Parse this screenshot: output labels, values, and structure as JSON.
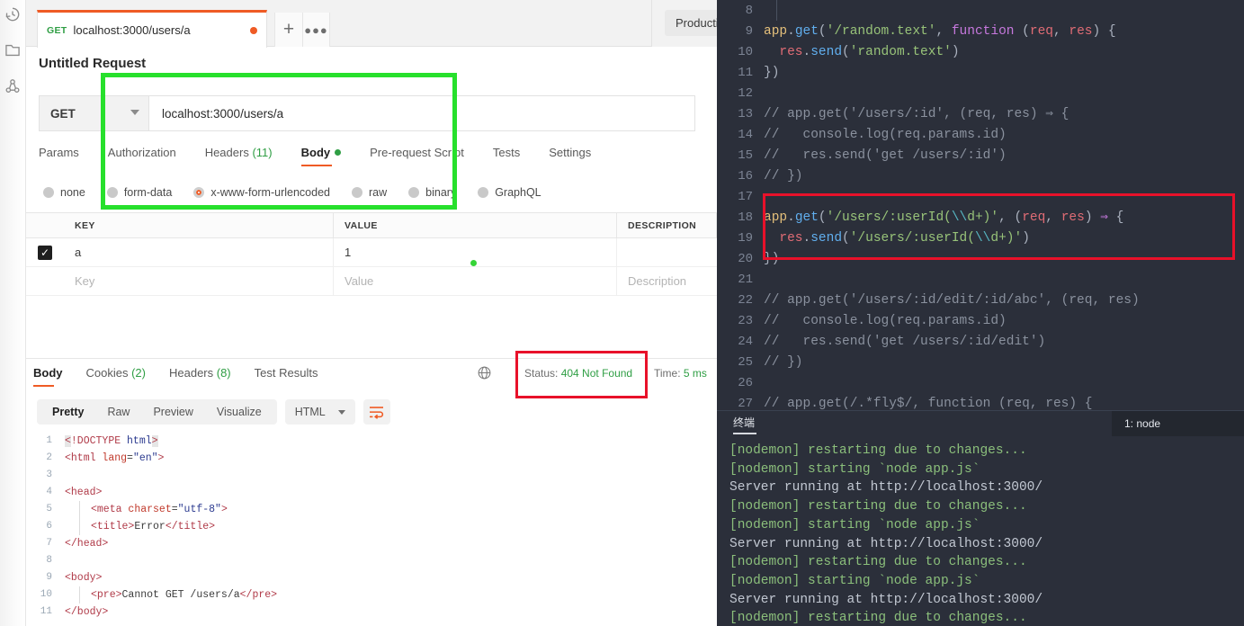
{
  "app": {
    "name": "Postman",
    "accent_orange": "#ef5b25",
    "accent_green": "#2f9e44",
    "annotation_green": "#27e02c",
    "annotation_red": "#e8112a"
  },
  "sidebar": {
    "items": [
      {
        "name": "history-icon",
        "label": "History"
      },
      {
        "name": "collections-icon",
        "label": "Collections"
      },
      {
        "name": "apis-icon",
        "label": "APIs"
      }
    ]
  },
  "tabstrip": {
    "tab": {
      "method": "GET",
      "title": "localhost:3000/users/a",
      "unsaved": true
    },
    "new_tab_label": "+",
    "more_label": "●●●",
    "environment": "Production"
  },
  "request": {
    "title": "Untitled Request",
    "method": "GET",
    "url": "localhost:3000/users/a",
    "tabs": [
      {
        "label": "Params",
        "active": false,
        "count": ""
      },
      {
        "label": "Authorization",
        "active": false,
        "count": ""
      },
      {
        "label": "Headers",
        "active": false,
        "count": "(11)"
      },
      {
        "label": "Body",
        "active": true,
        "count": "",
        "dot": true
      },
      {
        "label": "Pre-request Script",
        "active": false,
        "count": ""
      },
      {
        "label": "Tests",
        "active": false,
        "count": ""
      },
      {
        "label": "Settings",
        "active": false,
        "count": ""
      }
    ],
    "body_types": [
      {
        "label": "none",
        "selected": false
      },
      {
        "label": "form-data",
        "selected": false
      },
      {
        "label": "x-www-form-urlencoded",
        "selected": true
      },
      {
        "label": "raw",
        "selected": false
      },
      {
        "label": "binary",
        "selected": false
      },
      {
        "label": "GraphQL",
        "selected": false
      }
    ],
    "table": {
      "headers": [
        "KEY",
        "VALUE",
        "DESCRIPTION"
      ],
      "rows": [
        {
          "checked": true,
          "key": "a",
          "value": "1",
          "description": ""
        }
      ],
      "placeholders": {
        "key": "Key",
        "value": "Value",
        "description": "Description"
      }
    }
  },
  "response": {
    "tabs": [
      {
        "label": "Body",
        "active": true,
        "count": ""
      },
      {
        "label": "Cookies",
        "active": false,
        "count": "(2)"
      },
      {
        "label": "Headers",
        "active": false,
        "count": "(8)"
      },
      {
        "label": "Test Results",
        "active": false,
        "count": ""
      }
    ],
    "status_label": "Status:",
    "status_value": "404 Not Found",
    "time_label": "Time:",
    "time_value": "5 ms",
    "viewer": {
      "modes": [
        {
          "label": "Pretty",
          "active": true
        },
        {
          "label": "Raw",
          "active": false
        },
        {
          "label": "Preview",
          "active": false
        },
        {
          "label": "Visualize",
          "active": false
        }
      ],
      "language": "HTML",
      "wrap_icon": "word-wrap-icon"
    },
    "code_lines": [
      {
        "n": "1",
        "indent": false,
        "parts": [
          {
            "t": "<",
            "c": "tg",
            "sel": true
          },
          {
            "t": "!DOCTYPE ",
            "c": "tg"
          },
          {
            "t": "html",
            "c": "av"
          },
          {
            "t": ">",
            "c": "tg",
            "sel": true
          }
        ]
      },
      {
        "n": "2",
        "indent": false,
        "parts": [
          {
            "t": "<html ",
            "c": "tg"
          },
          {
            "t": "lang",
            "c": "at"
          },
          {
            "t": "=",
            "c": "pl"
          },
          {
            "t": "\"en\"",
            "c": "av"
          },
          {
            "t": ">",
            "c": "tg"
          }
        ]
      },
      {
        "n": "3",
        "indent": false,
        "parts": []
      },
      {
        "n": "4",
        "indent": false,
        "parts": [
          {
            "t": "<head>",
            "c": "tg"
          }
        ]
      },
      {
        "n": "5",
        "indent": true,
        "parts": [
          {
            "t": "    <meta ",
            "c": "tg"
          },
          {
            "t": "charset",
            "c": "at"
          },
          {
            "t": "=",
            "c": "pl"
          },
          {
            "t": "\"utf-8\"",
            "c": "av"
          },
          {
            "t": ">",
            "c": "tg"
          }
        ]
      },
      {
        "n": "6",
        "indent": true,
        "parts": [
          {
            "t": "    <title>",
            "c": "tg"
          },
          {
            "t": "Error",
            "c": "pl"
          },
          {
            "t": "</title>",
            "c": "tg"
          }
        ]
      },
      {
        "n": "7",
        "indent": false,
        "parts": [
          {
            "t": "</head>",
            "c": "tg"
          }
        ]
      },
      {
        "n": "8",
        "indent": false,
        "parts": []
      },
      {
        "n": "9",
        "indent": false,
        "parts": [
          {
            "t": "<body>",
            "c": "tg"
          }
        ]
      },
      {
        "n": "10",
        "indent": true,
        "parts": [
          {
            "t": "    <pre>",
            "c": "tg"
          },
          {
            "t": "Cannot GET /users/a",
            "c": "pl"
          },
          {
            "t": "</pre>",
            "c": "tg"
          }
        ]
      },
      {
        "n": "11",
        "indent": false,
        "parts": [
          {
            "t": "</body>",
            "c": "tg"
          }
        ]
      }
    ]
  },
  "editor": {
    "lines": [
      {
        "n": "8",
        "guide": false,
        "highlight": false,
        "parts": []
      },
      {
        "n": "9",
        "guide": false,
        "highlight": false,
        "parts": [
          {
            "t": "app",
            "c": "k-obj"
          },
          {
            "t": ".",
            "c": "k-pun"
          },
          {
            "t": "get",
            "c": "k-meth"
          },
          {
            "t": "(",
            "c": "k-pun"
          },
          {
            "t": "'/random.text'",
            "c": "k-str"
          },
          {
            "t": ", ",
            "c": "k-pun"
          },
          {
            "t": "function",
            "c": "k-fn"
          },
          {
            "t": " (",
            "c": "k-pun"
          },
          {
            "t": "req",
            "c": "k-par"
          },
          {
            "t": ", ",
            "c": "k-pun"
          },
          {
            "t": "res",
            "c": "k-par"
          },
          {
            "t": ") {",
            "c": "k-pun"
          }
        ]
      },
      {
        "n": "10",
        "guide": true,
        "highlight": false,
        "parts": [
          {
            "t": "  ",
            "c": "k-pun"
          },
          {
            "t": "res",
            "c": "k-par"
          },
          {
            "t": ".",
            "c": "k-pun"
          },
          {
            "t": "send",
            "c": "k-meth"
          },
          {
            "t": "(",
            "c": "k-pun"
          },
          {
            "t": "'random.text'",
            "c": "k-str"
          },
          {
            "t": ")",
            "c": "k-pun"
          }
        ]
      },
      {
        "n": "11",
        "guide": false,
        "highlight": false,
        "parts": [
          {
            "t": "})",
            "c": "k-pun"
          }
        ]
      },
      {
        "n": "12",
        "guide": false,
        "highlight": false,
        "parts": []
      },
      {
        "n": "13",
        "guide": false,
        "highlight": false,
        "parts": [
          {
            "t": "// app.get('/users/:id', (req, res) ⇒ {",
            "c": "k-com"
          }
        ]
      },
      {
        "n": "14",
        "guide": false,
        "highlight": false,
        "parts": [
          {
            "t": "//   console.log(req.params.id)",
            "c": "k-com"
          }
        ]
      },
      {
        "n": "15",
        "guide": false,
        "highlight": false,
        "parts": [
          {
            "t": "//   res.send('get /users/:id')",
            "c": "k-com"
          }
        ]
      },
      {
        "n": "16",
        "guide": false,
        "highlight": false,
        "parts": [
          {
            "t": "// })",
            "c": "k-com"
          }
        ]
      },
      {
        "n": "17",
        "guide": false,
        "highlight": false,
        "parts": []
      },
      {
        "n": "18",
        "guide": false,
        "highlight": true,
        "parts": [
          {
            "t": "app",
            "c": "k-obj"
          },
          {
            "t": ".",
            "c": "k-pun"
          },
          {
            "t": "get",
            "c": "k-meth"
          },
          {
            "t": "(",
            "c": "k-pun"
          },
          {
            "t": "'/users/:userId(",
            "c": "k-str"
          },
          {
            "t": "\\\\",
            "c": "k-esc"
          },
          {
            "t": "d+)'",
            "c": "k-str"
          },
          {
            "t": ", (",
            "c": "k-pun"
          },
          {
            "t": "req",
            "c": "k-par"
          },
          {
            "t": ", ",
            "c": "k-pun"
          },
          {
            "t": "res",
            "c": "k-par"
          },
          {
            "t": ") ",
            "c": "k-pun"
          },
          {
            "t": "⇒",
            "c": "k-arrow"
          },
          {
            "t": " {",
            "c": "k-pun"
          }
        ]
      },
      {
        "n": "19",
        "guide": true,
        "highlight": true,
        "parts": [
          {
            "t": "  ",
            "c": "k-pun"
          },
          {
            "t": "res",
            "c": "k-par"
          },
          {
            "t": ".",
            "c": "k-pun"
          },
          {
            "t": "send",
            "c": "k-meth"
          },
          {
            "t": "(",
            "c": "k-pun"
          },
          {
            "t": "'/users/:userId(",
            "c": "k-str"
          },
          {
            "t": "\\\\",
            "c": "k-esc"
          },
          {
            "t": "d+)'",
            "c": "k-str"
          },
          {
            "t": ")",
            "c": "k-pun"
          }
        ]
      },
      {
        "n": "20",
        "guide": false,
        "highlight": true,
        "parts": [
          {
            "t": "})",
            "c": "k-pun"
          }
        ]
      },
      {
        "n": "21",
        "guide": false,
        "highlight": false,
        "parts": []
      },
      {
        "n": "22",
        "guide": false,
        "highlight": false,
        "parts": [
          {
            "t": "// app.get('/users/:id/edit/:id/abc', (req, res)",
            "c": "k-com"
          }
        ]
      },
      {
        "n": "23",
        "guide": false,
        "highlight": false,
        "parts": [
          {
            "t": "//   console.log(req.params.id)",
            "c": "k-com"
          }
        ]
      },
      {
        "n": "24",
        "guide": false,
        "highlight": false,
        "parts": [
          {
            "t": "//   res.send('get /users/:id/edit')",
            "c": "k-com"
          }
        ]
      },
      {
        "n": "25",
        "guide": false,
        "highlight": false,
        "parts": [
          {
            "t": "// })",
            "c": "k-com"
          }
        ]
      },
      {
        "n": "26",
        "guide": false,
        "highlight": false,
        "parts": []
      },
      {
        "n": "27",
        "guide": false,
        "highlight": false,
        "parts": [
          {
            "t": "// app.get(/.*fly$/, function (req, res) {",
            "c": "k-com"
          }
        ]
      }
    ]
  },
  "terminal": {
    "panel_title": "终端",
    "active_process": "1: node",
    "lines": [
      {
        "text": "[nodemon] restarting due to changes...",
        "style": "t-green"
      },
      {
        "text": "[nodemon] starting `node app.js`",
        "style": "t-green"
      },
      {
        "text": "Server running at http://localhost:3000/",
        "style": "t-gray"
      },
      {
        "text": "[nodemon] restarting due to changes...",
        "style": "t-green"
      },
      {
        "text": "[nodemon] starting `node app.js`",
        "style": "t-green"
      },
      {
        "text": "Server running at http://localhost:3000/",
        "style": "t-gray"
      },
      {
        "text": "[nodemon] restarting due to changes...",
        "style": "t-green"
      },
      {
        "text": "[nodemon] starting `node app.js`",
        "style": "t-green"
      },
      {
        "text": "Server running at http://localhost:3000/",
        "style": "t-gray"
      },
      {
        "text": "[nodemon] restarting due to changes...",
        "style": "t-green"
      }
    ]
  },
  "annotations": [
    {
      "name": "green-highlight-box",
      "color": "#27e02c",
      "targets": "request body section"
    },
    {
      "name": "red-highlight-status",
      "color": "#e8112a",
      "targets": "404 Not Found status"
    },
    {
      "name": "red-highlight-route",
      "color": "#e8112a",
      "targets": "app.get userId regex route"
    }
  ]
}
